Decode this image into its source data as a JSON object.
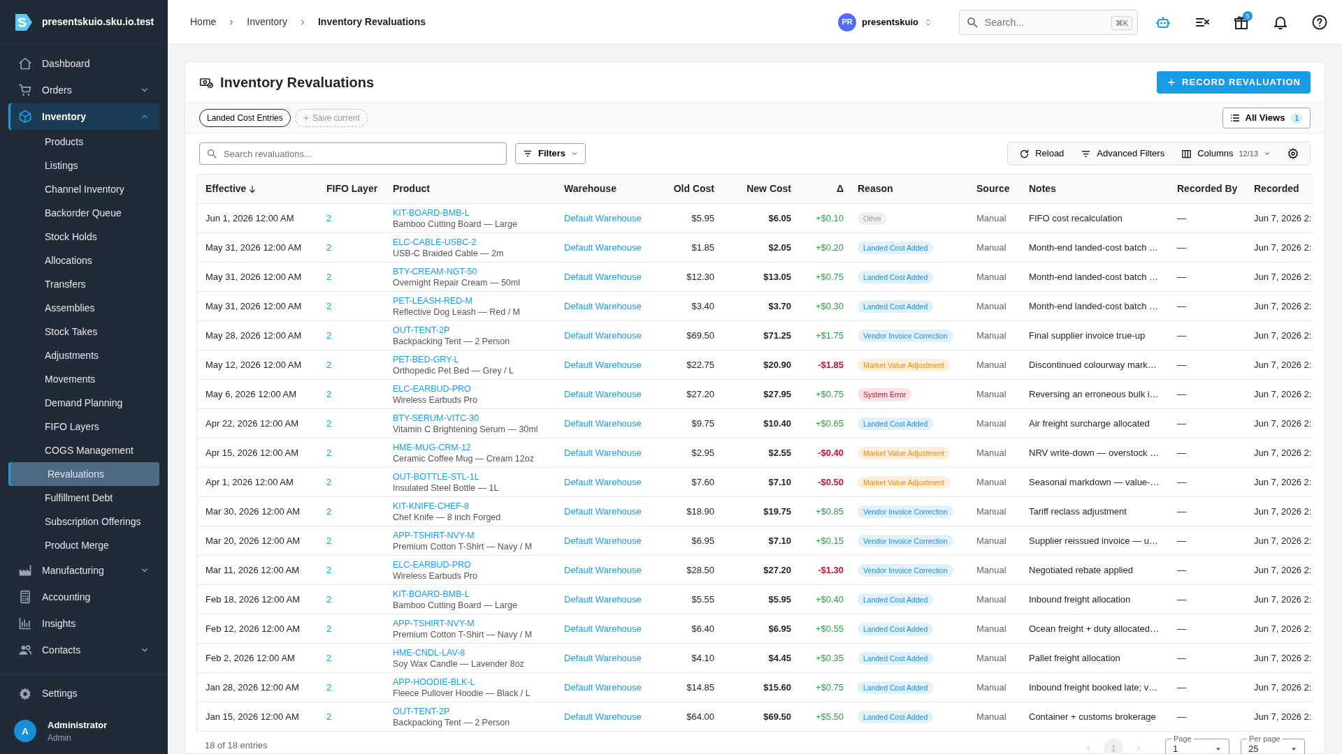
{
  "app": {
    "name": "presentskuio.sku.io.test"
  },
  "sidebar": {
    "items": [
      {
        "label": "Dashboard",
        "kind": "link",
        "selected": false
      },
      {
        "label": "Orders",
        "kind": "group",
        "expanded": false,
        "selected": false
      },
      {
        "label": "Inventory",
        "kind": "group",
        "expanded": true,
        "selected": true,
        "children": [
          {
            "label": "Products",
            "selected": false
          },
          {
            "label": "Listings",
            "selected": false
          },
          {
            "label": "Channel Inventory",
            "selected": false
          },
          {
            "label": "Backorder Queue",
            "selected": false
          },
          {
            "label": "Stock Holds",
            "selected": false
          },
          {
            "label": "Allocations",
            "selected": false
          },
          {
            "label": "Transfers",
            "selected": false
          },
          {
            "label": "Assemblies",
            "selected": false
          },
          {
            "label": "Stock Takes",
            "selected": false
          },
          {
            "label": "Adjustments",
            "selected": false
          },
          {
            "label": "Movements",
            "selected": false
          },
          {
            "label": "Demand Planning",
            "selected": false
          },
          {
            "label": "FIFO Layers",
            "selected": false
          },
          {
            "label": "COGS Management",
            "selected": false
          },
          {
            "label": "Revaluations",
            "selected": true
          },
          {
            "label": "Fulfillment Debt",
            "selected": false
          },
          {
            "label": "Subscription Offerings",
            "selected": false
          },
          {
            "label": "Product Merge",
            "selected": false
          }
        ]
      },
      {
        "label": "Manufacturing",
        "kind": "group",
        "expanded": false,
        "selected": false
      },
      {
        "label": "Accounting",
        "kind": "link",
        "selected": false
      },
      {
        "label": "Insights",
        "kind": "link",
        "selected": false
      },
      {
        "label": "Contacts",
        "kind": "group",
        "expanded": false,
        "selected": false
      }
    ],
    "settings": {
      "label": "Settings"
    },
    "user": {
      "initial": "A",
      "name": "Administrator",
      "role": "Admin"
    }
  },
  "topbar": {
    "breadcrumb": [
      "Home",
      "Inventory",
      "Inventory Revaluations"
    ],
    "account": {
      "initials": "PR",
      "name": "presentskuio"
    },
    "search": {
      "placeholder": "Search...",
      "shortcut": "⌘K"
    },
    "gift_badge": "5"
  },
  "page": {
    "title": "Inventory Revaluations",
    "primary_button": "RECORD REVALUATION",
    "views": [
      {
        "label": "Landed Cost Entries"
      }
    ],
    "save_current": "Save current",
    "all_views": {
      "label": "All Views",
      "count": "1"
    },
    "toolbar": {
      "search_placeholder": "Search revaluations...",
      "filters": "Filters",
      "reload": "Reload",
      "advanced_filters": "Advanced Filters",
      "columns": {
        "label": "Columns",
        "count": "12/13"
      }
    }
  },
  "table": {
    "columns": [
      {
        "label": "Effective",
        "sorted": true
      },
      {
        "label": "FIFO Layer",
        "sorted": false
      },
      {
        "label": "Product",
        "sorted": false
      },
      {
        "label": "Warehouse",
        "sorted": false
      },
      {
        "label": "Old Cost",
        "sorted": false
      },
      {
        "label": "New Cost",
        "sorted": false
      },
      {
        "label": "Δ",
        "sorted": false
      },
      {
        "label": "Reason",
        "sorted": false
      },
      {
        "label": "Source",
        "sorted": false
      },
      {
        "label": "Notes",
        "sorted": false
      },
      {
        "label": "Recorded By",
        "sorted": false
      },
      {
        "label": "Recorded",
        "sorted": false
      }
    ],
    "rows": [
      {
        "effective": "Jun 1, 2026 12:00 AM",
        "fifo_layer": "2",
        "sku": "KIT-BOARD-BMB-L",
        "product_name": "Bamboo Cutting Board — Large",
        "warehouse": "Default Warehouse",
        "old_cost": "$5.95",
        "new_cost": "$6.05",
        "delta": {
          "text": "+$0.10",
          "kind": "increase"
        },
        "reason": {
          "label": "Other",
          "kind": "other"
        },
        "source": "Manual",
        "notes": "FIFO cost recalculation",
        "recorded_by": "—",
        "recorded": "Jun 7, 2026 2:"
      },
      {
        "effective": "May 31, 2026 12:00 AM",
        "fifo_layer": "2",
        "sku": "ELC-CABLE-USBC-2",
        "product_name": "USB-C Braided Cable — 2m",
        "warehouse": "Default Warehouse",
        "old_cost": "$1.85",
        "new_cost": "$2.05",
        "delta": {
          "text": "+$0.20",
          "kind": "increase"
        },
        "reason": {
          "label": "Landed Cost Added",
          "kind": "landed"
        },
        "source": "Manual",
        "notes": "Month-end landed-cost batch …",
        "recorded_by": "—",
        "recorded": "Jun 7, 2026 2:"
      },
      {
        "effective": "May 31, 2026 12:00 AM",
        "fifo_layer": "2",
        "sku": "BTY-CREAM-NGT-50",
        "product_name": "Overnight Repair Cream — 50ml",
        "warehouse": "Default Warehouse",
        "old_cost": "$12.30",
        "new_cost": "$13.05",
        "delta": {
          "text": "+$0.75",
          "kind": "increase"
        },
        "reason": {
          "label": "Landed Cost Added",
          "kind": "landed"
        },
        "source": "Manual",
        "notes": "Month-end landed-cost batch …",
        "recorded_by": "—",
        "recorded": "Jun 7, 2026 2:"
      },
      {
        "effective": "May 31, 2026 12:00 AM",
        "fifo_layer": "2",
        "sku": "PET-LEASH-RED-M",
        "product_name": "Reflective Dog Leash — Red / M",
        "warehouse": "Default Warehouse",
        "old_cost": "$3.40",
        "new_cost": "$3.70",
        "delta": {
          "text": "+$0.30",
          "kind": "increase"
        },
        "reason": {
          "label": "Landed Cost Added",
          "kind": "landed"
        },
        "source": "Manual",
        "notes": "Month-end landed-cost batch …",
        "recorded_by": "—",
        "recorded": "Jun 7, 2026 2:"
      },
      {
        "effective": "May 28, 2026 12:00 AM",
        "fifo_layer": "2",
        "sku": "OUT-TENT-2P",
        "product_name": "Backpacking Tent — 2 Person",
        "warehouse": "Default Warehouse",
        "old_cost": "$69.50",
        "new_cost": "$71.25",
        "delta": {
          "text": "+$1.75",
          "kind": "increase"
        },
        "reason": {
          "label": "Vendor Invoice Correction",
          "kind": "vendor"
        },
        "source": "Manual",
        "notes": "Final supplier invoice true-up",
        "recorded_by": "—",
        "recorded": "Jun 7, 2026 2:"
      },
      {
        "effective": "May 12, 2026 12:00 AM",
        "fifo_layer": "2",
        "sku": "PET-BED-GRY-L",
        "product_name": "Orthopedic Pet Bed — Grey / L",
        "warehouse": "Default Warehouse",
        "old_cost": "$22.75",
        "new_cost": "$20.90",
        "delta": {
          "text": "-$1.85",
          "kind": "decrease"
        },
        "reason": {
          "label": "Market Value Adjustment",
          "kind": "market"
        },
        "source": "Manual",
        "notes": "Discontinued colourway mark…",
        "recorded_by": "—",
        "recorded": "Jun 7, 2026 2:"
      },
      {
        "effective": "May 6, 2026 12:00 AM",
        "fifo_layer": "2",
        "sku": "ELC-EARBUD-PRO",
        "product_name": "Wireless Earbuds Pro",
        "warehouse": "Default Warehouse",
        "old_cost": "$27.20",
        "new_cost": "$27.95",
        "delta": {
          "text": "+$0.75",
          "kind": "increase"
        },
        "reason": {
          "label": "System Error",
          "kind": "error"
        },
        "source": "Manual",
        "notes": "Reversing an erroneous bulk i…",
        "recorded_by": "—",
        "recorded": "Jun 7, 2026 2:"
      },
      {
        "effective": "Apr 22, 2026 12:00 AM",
        "fifo_layer": "2",
        "sku": "BTY-SERUM-VITC-30",
        "product_name": "Vitamin C Brightening Serum — 30ml",
        "warehouse": "Default Warehouse",
        "old_cost": "$9.75",
        "new_cost": "$10.40",
        "delta": {
          "text": "+$0.65",
          "kind": "increase"
        },
        "reason": {
          "label": "Landed Cost Added",
          "kind": "landed"
        },
        "source": "Manual",
        "notes": "Air freight surcharge allocated",
        "recorded_by": "—",
        "recorded": "Jun 7, 2026 2:"
      },
      {
        "effective": "Apr 15, 2026 12:00 AM",
        "fifo_layer": "2",
        "sku": "HME-MUG-CRM-12",
        "product_name": "Ceramic Coffee Mug — Cream 12oz",
        "warehouse": "Default Warehouse",
        "old_cost": "$2.95",
        "new_cost": "$2.55",
        "delta": {
          "text": "-$0.40",
          "kind": "decrease"
        },
        "reason": {
          "label": "Market Value Adjustment",
          "kind": "market"
        },
        "source": "Manual",
        "notes": "NRV write-down — overstock …",
        "recorded_by": "—",
        "recorded": "Jun 7, 2026 2:"
      },
      {
        "effective": "Apr 1, 2026 12:00 AM",
        "fifo_layer": "2",
        "sku": "OUT-BOTTLE-STL-1L",
        "product_name": "Insulated Steel Bottle — 1L",
        "warehouse": "Default Warehouse",
        "old_cost": "$7.60",
        "new_cost": "$7.10",
        "delta": {
          "text": "-$0.50",
          "kind": "decrease"
        },
        "reason": {
          "label": "Market Value Adjustment",
          "kind": "market"
        },
        "source": "Manual",
        "notes": "Seasonal markdown — value-…",
        "recorded_by": "—",
        "recorded": "Jun 7, 2026 2:"
      },
      {
        "effective": "Mar 30, 2026 12:00 AM",
        "fifo_layer": "2",
        "sku": "KIT-KNIFE-CHEF-8",
        "product_name": "Chef Knife — 8 inch Forged",
        "warehouse": "Default Warehouse",
        "old_cost": "$18.90",
        "new_cost": "$19.75",
        "delta": {
          "text": "+$0.85",
          "kind": "increase"
        },
        "reason": {
          "label": "Vendor Invoice Correction",
          "kind": "vendor"
        },
        "source": "Manual",
        "notes": "Tariff reclass adjustment",
        "recorded_by": "—",
        "recorded": "Jun 7, 2026 2:"
      },
      {
        "effective": "Mar 20, 2026 12:00 AM",
        "fifo_layer": "2",
        "sku": "APP-TSHIRT-NVY-M",
        "product_name": "Premium Cotton T-Shirt — Navy / M",
        "warehouse": "Default Warehouse",
        "old_cost": "$6.95",
        "new_cost": "$7.10",
        "delta": {
          "text": "+$0.15",
          "kind": "increase"
        },
        "reason": {
          "label": "Vendor Invoice Correction",
          "kind": "vendor"
        },
        "source": "Manual",
        "notes": "Supplier reissued invoice — u…",
        "recorded_by": "—",
        "recorded": "Jun 7, 2026 2:"
      },
      {
        "effective": "Mar 11, 2026 12:00 AM",
        "fifo_layer": "2",
        "sku": "ELC-EARBUD-PRO",
        "product_name": "Wireless Earbuds Pro",
        "warehouse": "Default Warehouse",
        "old_cost": "$28.50",
        "new_cost": "$27.20",
        "delta": {
          "text": "-$1.30",
          "kind": "decrease"
        },
        "reason": {
          "label": "Vendor Invoice Correction",
          "kind": "vendor"
        },
        "source": "Manual",
        "notes": "Negotiated rebate applied",
        "recorded_by": "—",
        "recorded": "Jun 7, 2026 2:"
      },
      {
        "effective": "Feb 18, 2026 12:00 AM",
        "fifo_layer": "2",
        "sku": "KIT-BOARD-BMB-L",
        "product_name": "Bamboo Cutting Board — Large",
        "warehouse": "Default Warehouse",
        "old_cost": "$5.55",
        "new_cost": "$5.95",
        "delta": {
          "text": "+$0.40",
          "kind": "increase"
        },
        "reason": {
          "label": "Landed Cost Added",
          "kind": "landed"
        },
        "source": "Manual",
        "notes": "Inbound freight allocation",
        "recorded_by": "—",
        "recorded": "Jun 7, 2026 2:"
      },
      {
        "effective": "Feb 12, 2026 12:00 AM",
        "fifo_layer": "2",
        "sku": "APP-TSHIRT-NVY-M",
        "product_name": "Premium Cotton T-Shirt — Navy / M",
        "warehouse": "Default Warehouse",
        "old_cost": "$6.40",
        "new_cost": "$6.95",
        "delta": {
          "text": "+$0.55",
          "kind": "increase"
        },
        "reason": {
          "label": "Landed Cost Added",
          "kind": "landed"
        },
        "source": "Manual",
        "notes": "Ocean freight + duty allocated…",
        "recorded_by": "—",
        "recorded": "Jun 7, 2026 2:"
      },
      {
        "effective": "Feb 2, 2026 12:00 AM",
        "fifo_layer": "2",
        "sku": "HME-CNDL-LAV-8",
        "product_name": "Soy Wax Candle — Lavender 8oz",
        "warehouse": "Default Warehouse",
        "old_cost": "$4.10",
        "new_cost": "$4.45",
        "delta": {
          "text": "+$0.35",
          "kind": "increase"
        },
        "reason": {
          "label": "Landed Cost Added",
          "kind": "landed"
        },
        "source": "Manual",
        "notes": "Pallet freight allocation",
        "recorded_by": "—",
        "recorded": "Jun 7, 2026 2:"
      },
      {
        "effective": "Jan 28, 2026 12:00 AM",
        "fifo_layer": "2",
        "sku": "APP-HOODIE-BLK-L",
        "product_name": "Fleece Pullover Hoodie — Black / L",
        "warehouse": "Default Warehouse",
        "old_cost": "$14.85",
        "new_cost": "$15.60",
        "delta": {
          "text": "+$0.75",
          "kind": "increase"
        },
        "reason": {
          "label": "Landed Cost Added",
          "kind": "landed"
        },
        "source": "Manual",
        "notes": "Inbound freight booked late; v…",
        "recorded_by": "—",
        "recorded": "Jun 7, 2026 2:"
      },
      {
        "effective": "Jan 15, 2026 12:00 AM",
        "fifo_layer": "2",
        "sku": "OUT-TENT-2P",
        "product_name": "Backpacking Tent — 2 Person",
        "warehouse": "Default Warehouse",
        "old_cost": "$64.00",
        "new_cost": "$69.50",
        "delta": {
          "text": "+$5.50",
          "kind": "increase"
        },
        "reason": {
          "label": "Landed Cost Added",
          "kind": "landed"
        },
        "source": "Manual",
        "notes": "Container + customs brokerage",
        "recorded_by": "—",
        "recorded": "Jun 7, 2026 2:"
      }
    ]
  },
  "footer": {
    "entries": "18 of 18 entries",
    "current_page": "1",
    "page_label": "Page",
    "page_value": "1",
    "per_page_label": "Per page",
    "per_page_value": "25"
  }
}
